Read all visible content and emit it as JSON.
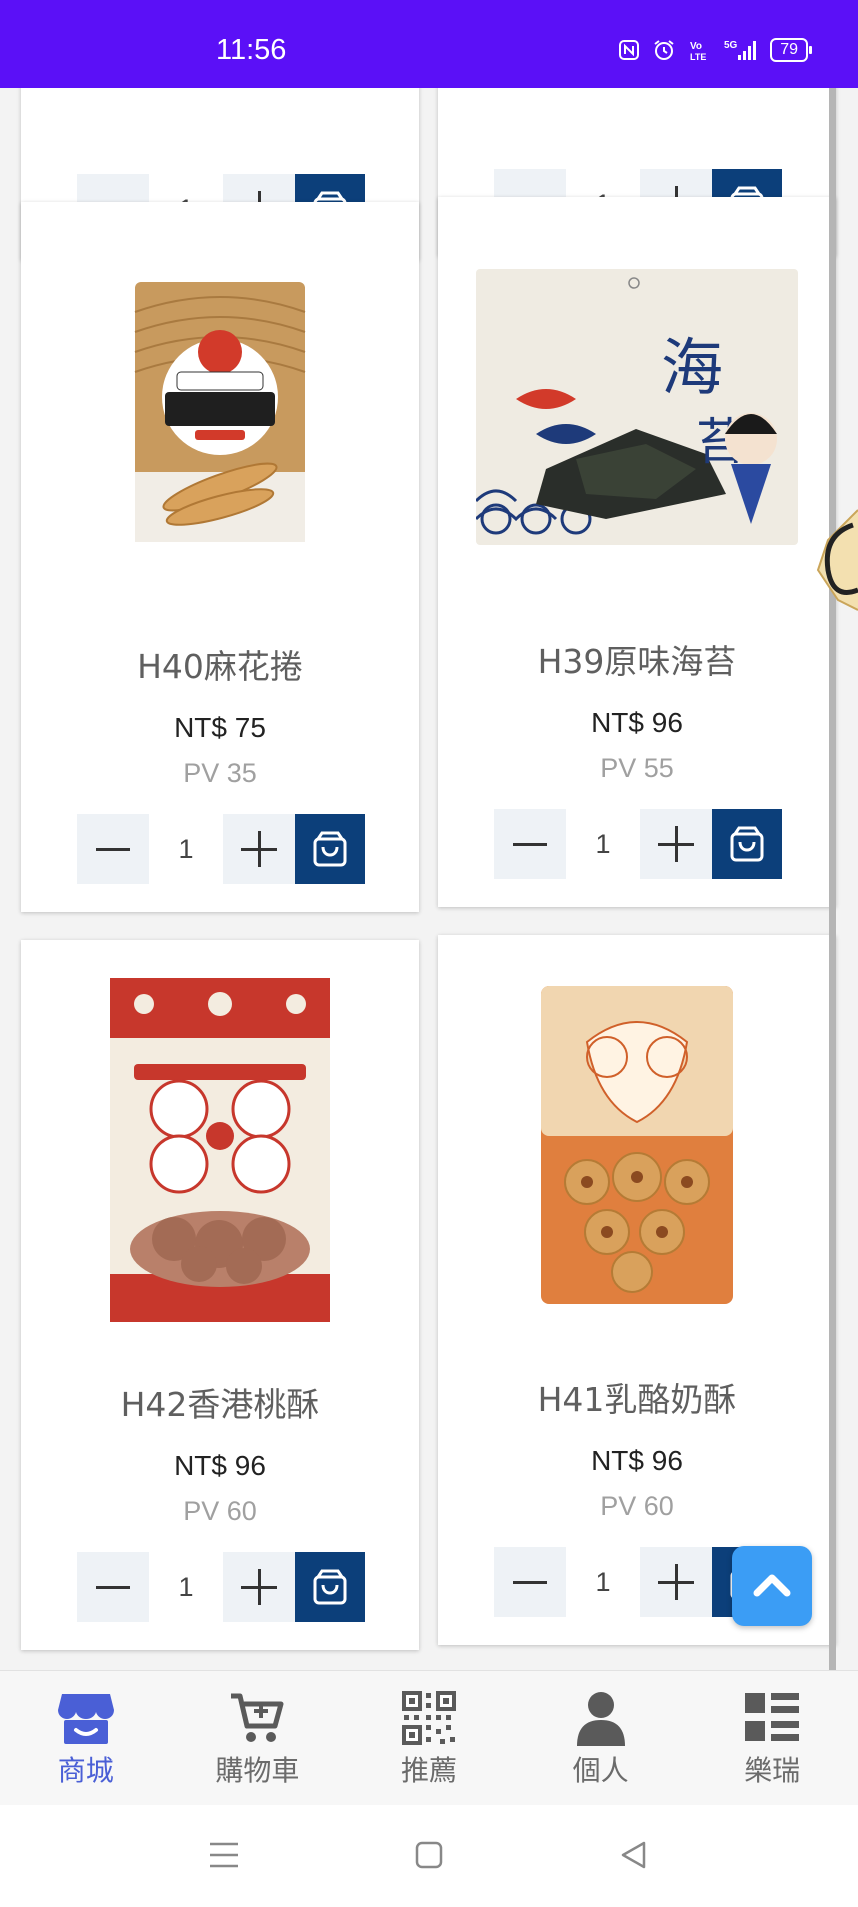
{
  "status_bar": {
    "time": "11:56",
    "icons": [
      "nfc-icon",
      "alarm-icon",
      "volte-icon",
      "5g-signal-icon"
    ],
    "battery": "79",
    "background": "#5b10f7"
  },
  "products_top_row": [
    {
      "quantity": "1"
    },
    {
      "quantity": "1"
    }
  ],
  "products": [
    {
      "name": "H40麻花捲",
      "price": "NT$ 75",
      "pv": "PV 35",
      "quantity": "1",
      "image_icon": "product-image-mahua"
    },
    {
      "name": "H39原味海苔",
      "price": "NT$ 96",
      "pv": "PV 55",
      "quantity": "1",
      "image_icon": "product-image-seaweed"
    },
    {
      "name": "H42香港桃酥",
      "price": "NT$ 96",
      "pv": "PV 60",
      "quantity": "1",
      "image_icon": "product-image-walnut-cookie"
    },
    {
      "name": "H41乳酪奶酥",
      "price": "NT$ 96",
      "pv": "PV 60",
      "quantity": "1",
      "image_icon": "product-image-cheese-cookie"
    }
  ],
  "bottom_nav": [
    {
      "label": "商城",
      "icon": "store-icon",
      "active": true
    },
    {
      "label": "購物車",
      "icon": "cart-icon",
      "active": false
    },
    {
      "label": "推薦",
      "icon": "qr-code-icon",
      "active": false
    },
    {
      "label": "個人",
      "icon": "person-icon",
      "active": false
    },
    {
      "label": "樂瑞",
      "icon": "grid-list-icon",
      "active": false
    }
  ],
  "colors": {
    "cart_button": "#0c3f7a",
    "active_nav": "#4a5fd6",
    "scroll_top_button": "#3b9df5"
  }
}
